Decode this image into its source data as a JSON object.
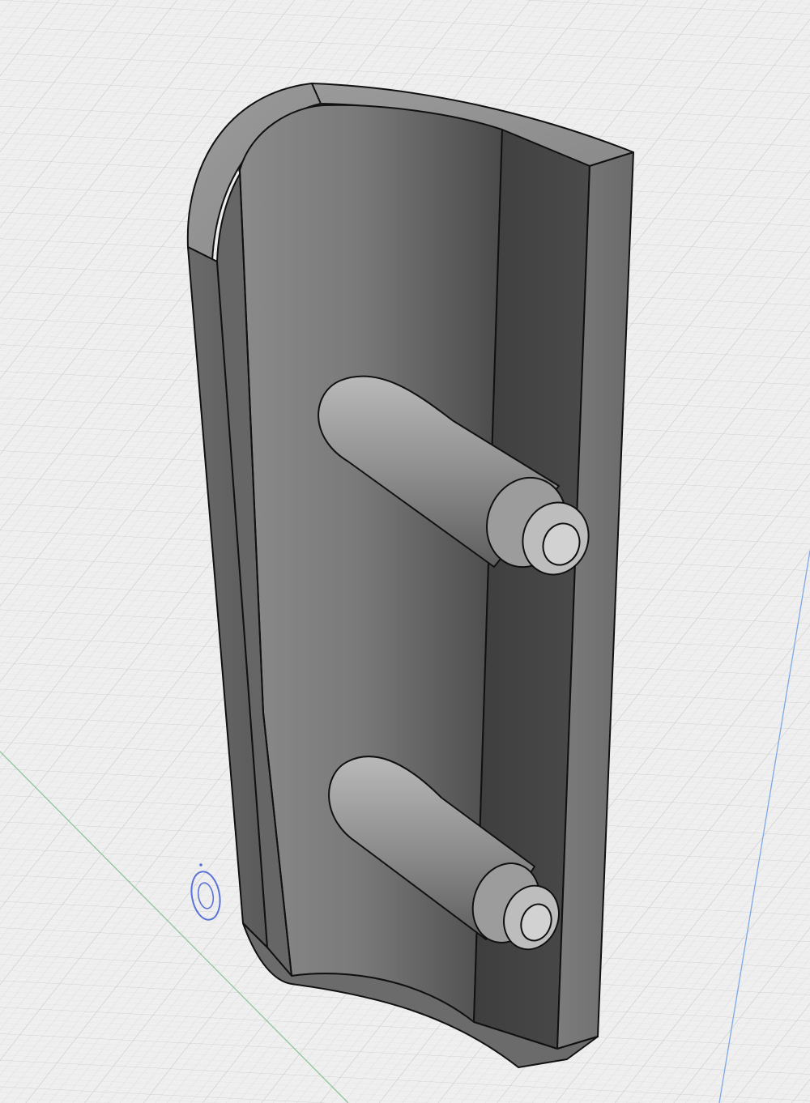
{
  "viewport": {
    "background": "#efefef",
    "grid_minor_color": "#dcdcdc",
    "grid_major_color": "#cfcfcf"
  },
  "axes": {
    "x_axis_color": "#8fc49a",
    "y_axis_color": "#7fa8e6"
  },
  "model": {
    "body_color": "#6e6e6e",
    "edge_color": "#111111",
    "boss_count": 2
  },
  "origin_marker": {
    "color": "#5b73d6"
  }
}
